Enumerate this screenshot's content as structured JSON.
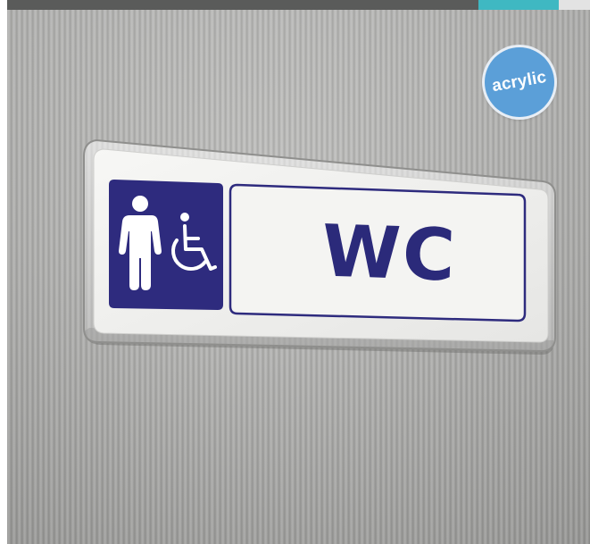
{
  "header_bar": {
    "colors": {
      "dark": "#5a5b5a",
      "accent": "#3fb8c2",
      "light": "#e3e3e3"
    }
  },
  "photo": {
    "wall_color": "#b4b4b2"
  },
  "sign": {
    "text": "WC",
    "text_color": "#2b2a7a",
    "panel_color": "#2e2b7e",
    "plate_color": "#f2f2f0",
    "icons": [
      "male-figure-icon",
      "wheelchair-icon"
    ]
  },
  "badge": {
    "label": "acrylic",
    "color": "#5b9fd8"
  }
}
